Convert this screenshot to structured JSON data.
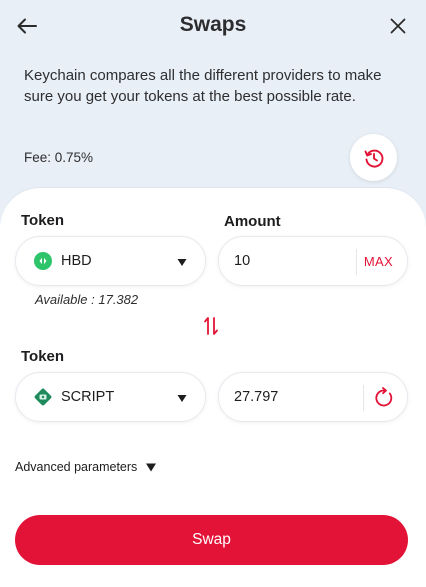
{
  "header": {
    "title": "Swaps"
  },
  "info": {
    "description": "Keychain compares all the different providers to make sure you get your tokens at the best possible rate.",
    "fee": "Fee: 0.75%"
  },
  "from": {
    "token_label": "Token",
    "amount_label": "Amount",
    "token": "HBD",
    "token_icon": "hbd-logo",
    "amount": "10",
    "max_label": "MAX",
    "available": "Available : 17.382"
  },
  "to": {
    "token_label": "Token",
    "token": "SCRIPT",
    "token_icon": "script-token-logo",
    "amount": "27.797"
  },
  "advanced": {
    "label": "Advanced parameters"
  },
  "actions": {
    "swap_label": "Swap"
  },
  "colors": {
    "accent": "#e31337",
    "background": "#e8eff7",
    "card": "#ffffff"
  }
}
